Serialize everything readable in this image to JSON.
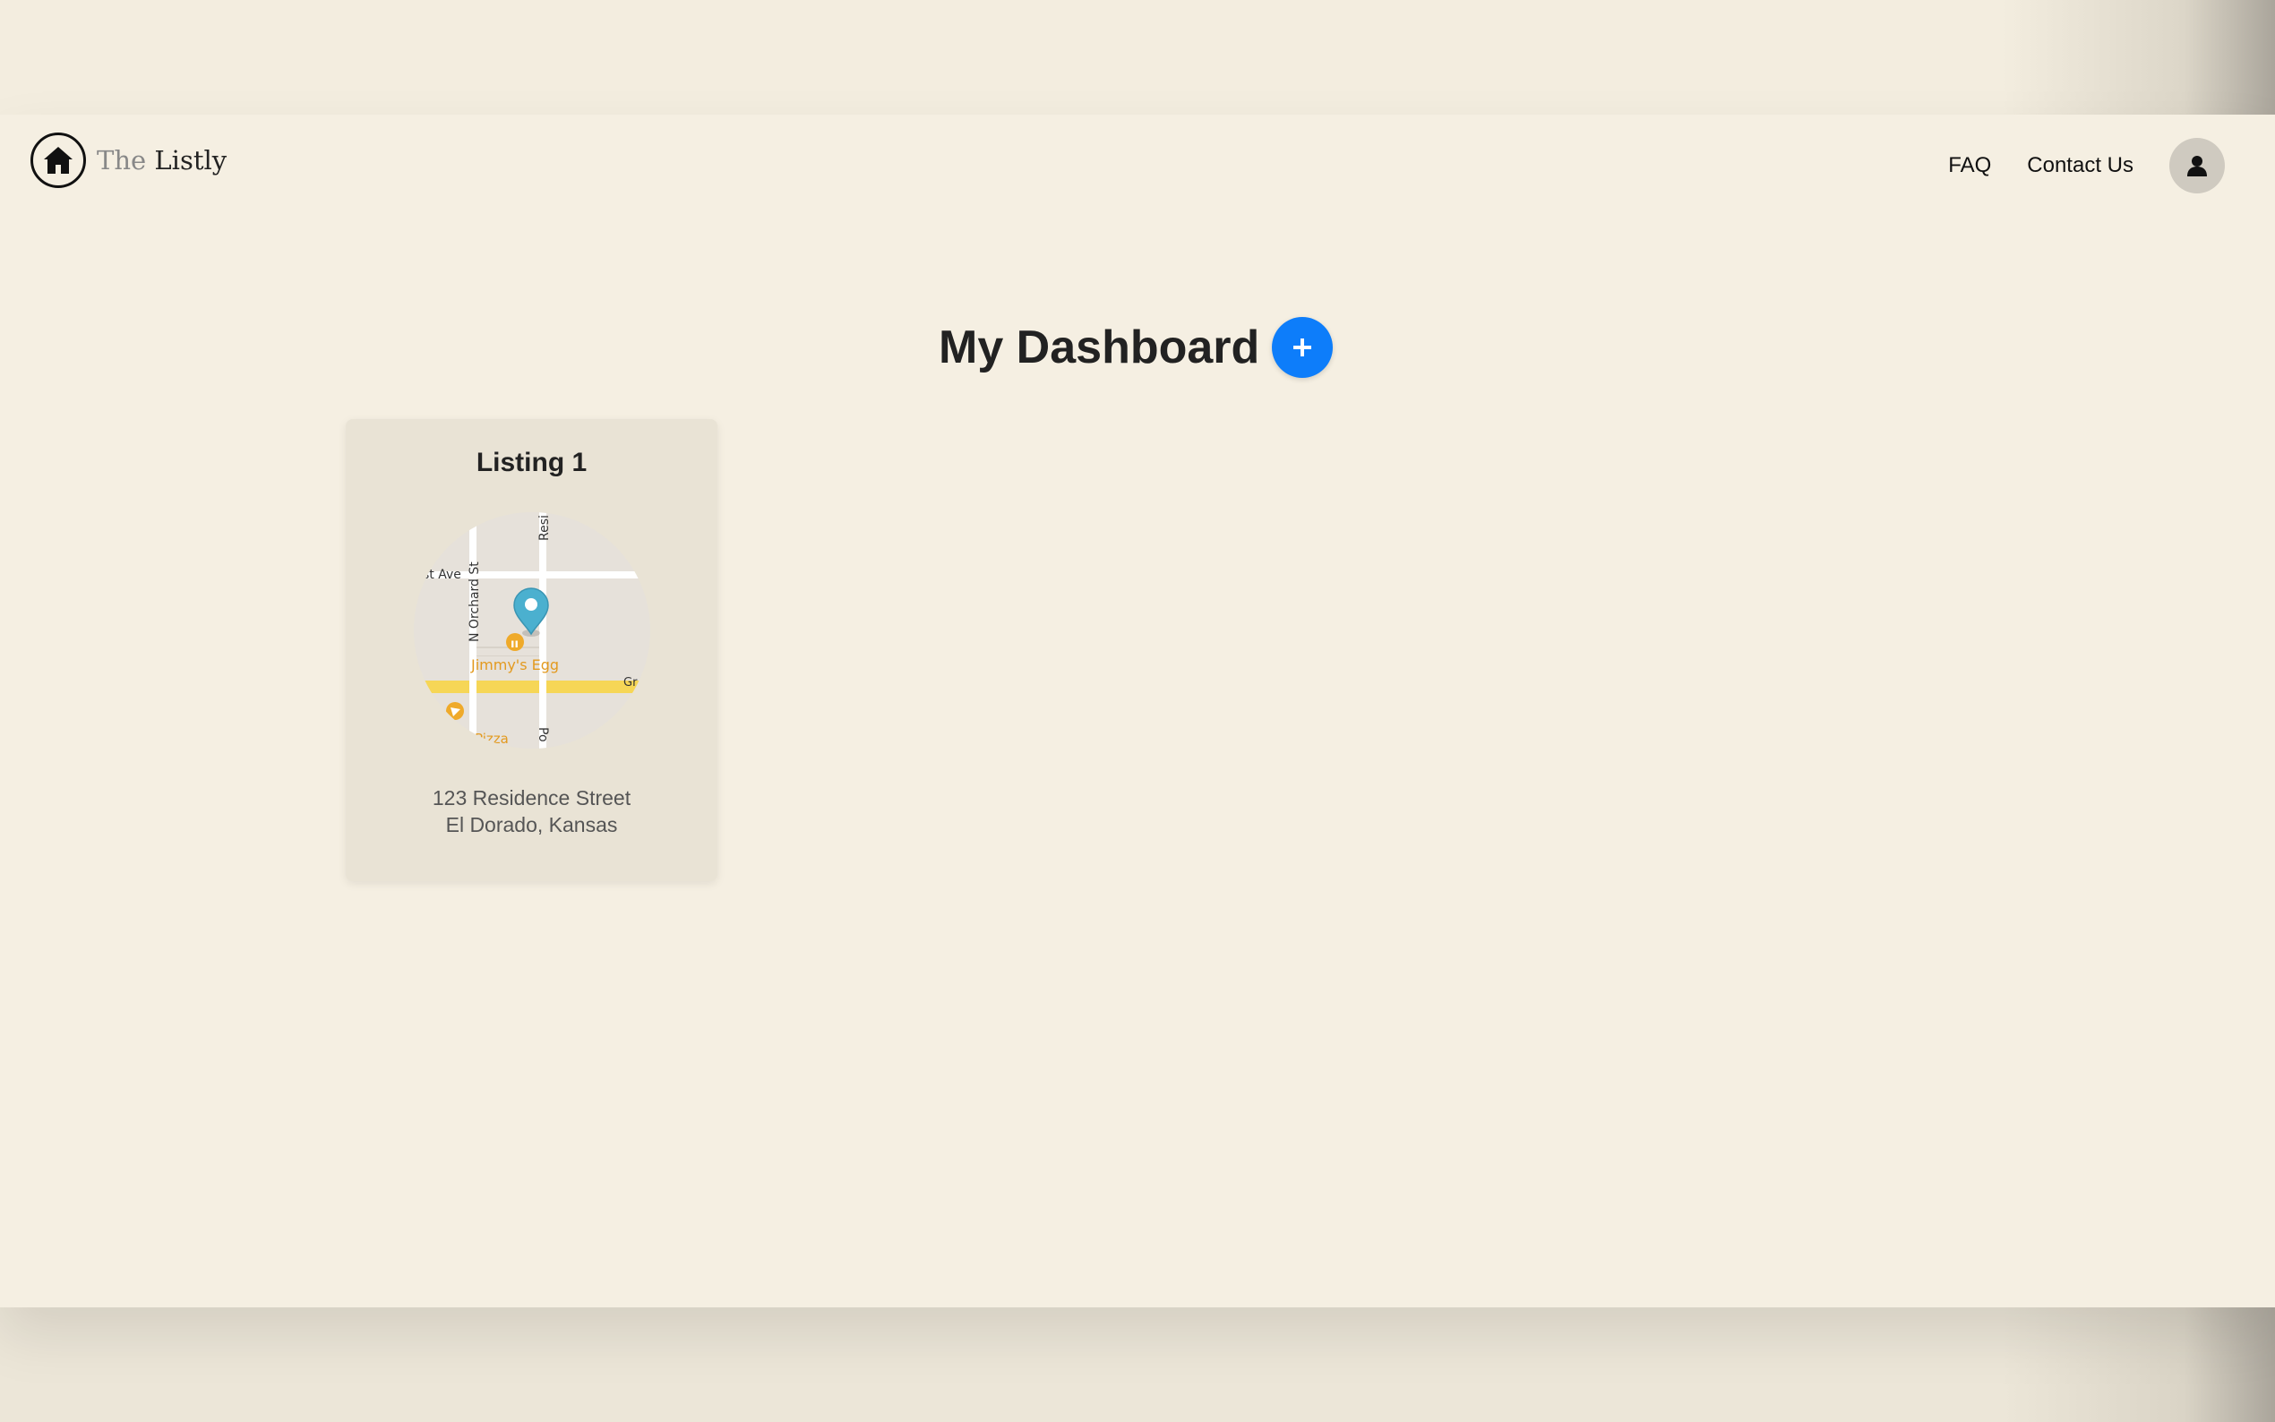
{
  "header": {
    "logo_prefix": "The",
    "logo_name": "Listly",
    "nav_faq": "FAQ",
    "nav_contact": "Contact Us"
  },
  "main": {
    "title": "My Dashboard",
    "add_icon": "plus-icon"
  },
  "listings": [
    {
      "title": "Listing 1",
      "address_line1": "123 Residence Street",
      "address_line2": "El Dorado, Kansas",
      "map": {
        "street_ave": "st Ave",
        "street_orchard": "N Orchard St",
        "street_resi": "Resi",
        "street_po": "Po",
        "street_gr": "Gr",
        "poi_restaurant": "Jimmy's Egg",
        "poi_pizza": "Pizza"
      }
    }
  ],
  "colors": {
    "accent": "#0d7dfa",
    "page_bg": "#f5efe2",
    "card_bg": "#e9e3d5",
    "pin": "#4bb0cf",
    "poi": "#e39a1f"
  },
  "icons": {
    "logo": "home-icon",
    "avatar": "user-icon",
    "pin": "map-pin-icon"
  }
}
